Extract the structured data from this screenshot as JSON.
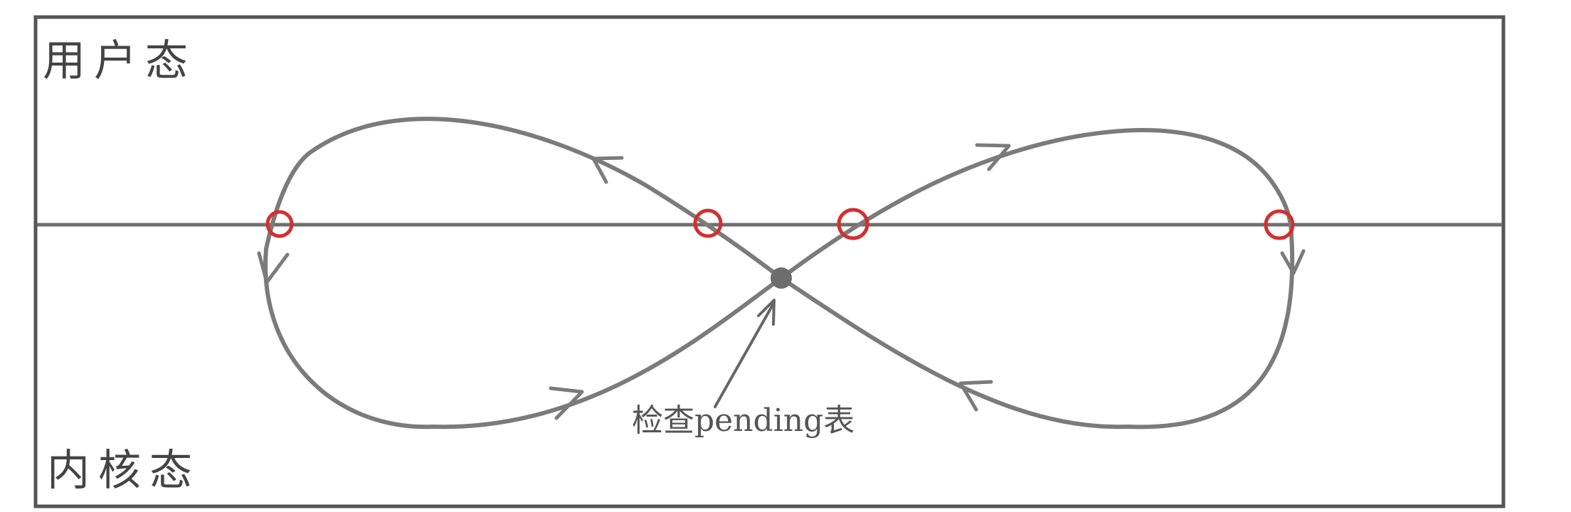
{
  "labels": {
    "user_mode": "用户态",
    "kernel_mode": "内核态",
    "annotation": "检查pending表"
  },
  "colors": {
    "marker": "#d32f2f"
  },
  "icons": {
    "direction": "arrowhead-icon",
    "crossing": "circle-marker-icon",
    "check_point": "dot-icon"
  }
}
